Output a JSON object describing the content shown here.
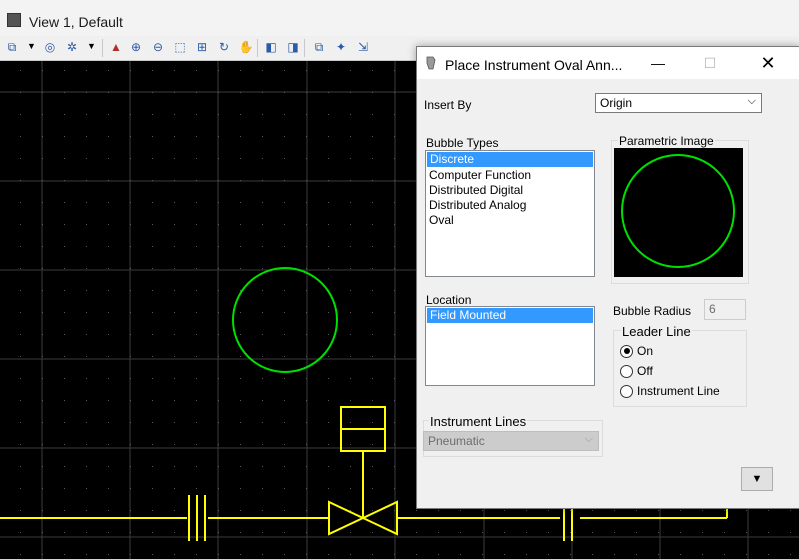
{
  "window": {
    "title": "View 1, Default"
  },
  "toolbar": {
    "icons": [
      "view-attributes-icon",
      "levels-display-icon",
      "render-icon",
      "update-view-icon",
      "zoom-in-icon",
      "zoom-out-icon",
      "window-area-icon",
      "fit-view-icon",
      "rotate-view-icon",
      "pan-icon",
      "view-previous-icon",
      "view-next-icon",
      "copy-view-icon",
      "camera-icon",
      "navigate-icon"
    ]
  },
  "drawing": {
    "colors": {
      "grid": "#3c3c3c",
      "dot": "#5a5a5a",
      "bubble": "#00e000",
      "lines": "#ffff00",
      "background": "#000000"
    }
  },
  "dialog": {
    "title": "Place Instrument Oval Ann...",
    "insert_by": {
      "label": "Insert By",
      "value": "Origin"
    },
    "bubble_types": {
      "label": "Bubble Types",
      "items": [
        "Discrete",
        "Computer Function",
        "Distributed Digital",
        "Distributed Analog",
        "Oval"
      ],
      "selected": "Discrete"
    },
    "parametric_image": {
      "label": "Parametric Image"
    },
    "location": {
      "label": "Location",
      "items": [
        "Field Mounted"
      ],
      "selected": "Field Mounted"
    },
    "bubble_radius": {
      "label": "Bubble Radius",
      "value": "6"
    },
    "leader_line": {
      "label": "Leader Line",
      "options": [
        "On",
        "Off",
        "Instrument Line"
      ],
      "selected": "On"
    },
    "instrument_lines": {
      "label": "Instrument Lines",
      "value": "Pneumatic"
    },
    "expand_button": "▼"
  }
}
